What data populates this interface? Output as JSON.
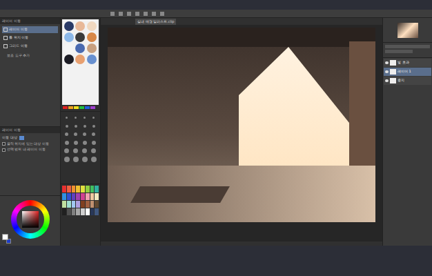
{
  "document_tab": {
    "label": "실내 배경 일러스트.clip"
  },
  "sub_tool": {
    "title": "레이어 이동",
    "items": [
      {
        "label": "레이어 이동",
        "selected": true
      },
      {
        "label": "툴 위치 이동",
        "selected": false
      },
      {
        "label": "그리드 이동",
        "selected": false
      }
    ],
    "add_button": "보조 도구 추가"
  },
  "tool_property": {
    "title": "레이어 이동",
    "heading": "이동 대상",
    "options": [
      {
        "label": "클릭 위치에 있는 대상 이동",
        "checked": false
      },
      {
        "label": "선택 범위 내 레이어 이동",
        "checked": false
      }
    ]
  },
  "palette_blobs": [
    "#2a3a66",
    "#e8b898",
    "#f0d8c0",
    "#8cb8e8",
    "#3a3a3a",
    "#d88848",
    "#f4f4f4",
    "#4a6ab0",
    "#c8a080",
    "#1c1c24",
    "#e8a070",
    "#6890d0"
  ],
  "palette_strip": [
    "#e02020",
    "#f0a020",
    "#f0e020",
    "#20c040",
    "#2060e0",
    "#a040d0"
  ],
  "color_set": [
    "#e83030",
    "#f06040",
    "#f09030",
    "#f0c030",
    "#e0e040",
    "#90d040",
    "#40c060",
    "#30b0a0",
    "#3090e0",
    "#3050d0",
    "#6040c0",
    "#a040b0",
    "#d04090",
    "#f0a0b0",
    "#f0c8a0",
    "#f0e8c0",
    "#c0e0a0",
    "#a0e0d0",
    "#a0c8f0",
    "#b0a0e0",
    "#804020",
    "#a06040",
    "#c09070",
    "#604830",
    "#202020",
    "#505050",
    "#808080",
    "#a8a8a8",
    "#d0d0d0",
    "#ffffff",
    "#283858",
    "#405880"
  ],
  "main_color": "#ffffff",
  "sub_color": "#1e3cc8",
  "layers": [
    {
      "name": "빛 효과",
      "visible": true,
      "selected": false
    },
    {
      "name": "레이어 1",
      "visible": true,
      "selected": true
    },
    {
      "name": "용지",
      "visible": true,
      "selected": false
    }
  ]
}
